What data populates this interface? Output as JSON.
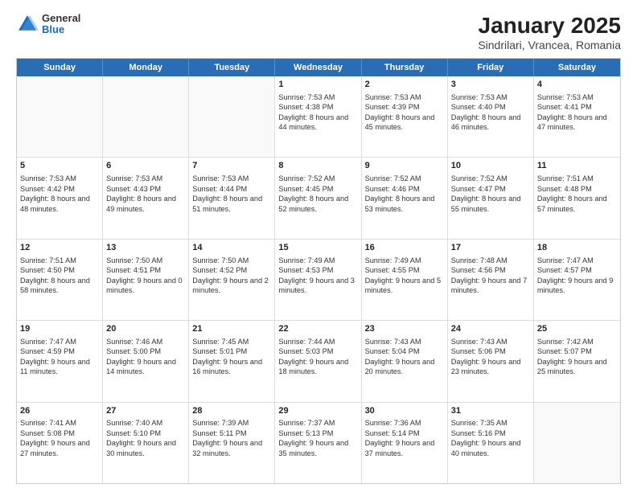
{
  "logo": {
    "general": "General",
    "blue": "Blue"
  },
  "title": "January 2025",
  "subtitle": "Sindrilari, Vrancea, Romania",
  "headers": [
    "Sunday",
    "Monday",
    "Tuesday",
    "Wednesday",
    "Thursday",
    "Friday",
    "Saturday"
  ],
  "weeks": [
    [
      {
        "day": "",
        "empty": true
      },
      {
        "day": "",
        "empty": true
      },
      {
        "day": "",
        "empty": true
      },
      {
        "day": "1",
        "sunrise": "Sunrise: 7:53 AM",
        "sunset": "Sunset: 4:38 PM",
        "daylight": "Daylight: 8 hours and 44 minutes."
      },
      {
        "day": "2",
        "sunrise": "Sunrise: 7:53 AM",
        "sunset": "Sunset: 4:39 PM",
        "daylight": "Daylight: 8 hours and 45 minutes."
      },
      {
        "day": "3",
        "sunrise": "Sunrise: 7:53 AM",
        "sunset": "Sunset: 4:40 PM",
        "daylight": "Daylight: 8 hours and 46 minutes."
      },
      {
        "day": "4",
        "sunrise": "Sunrise: 7:53 AM",
        "sunset": "Sunset: 4:41 PM",
        "daylight": "Daylight: 8 hours and 47 minutes."
      }
    ],
    [
      {
        "day": "5",
        "sunrise": "Sunrise: 7:53 AM",
        "sunset": "Sunset: 4:42 PM",
        "daylight": "Daylight: 8 hours and 48 minutes."
      },
      {
        "day": "6",
        "sunrise": "Sunrise: 7:53 AM",
        "sunset": "Sunset: 4:43 PM",
        "daylight": "Daylight: 8 hours and 49 minutes."
      },
      {
        "day": "7",
        "sunrise": "Sunrise: 7:53 AM",
        "sunset": "Sunset: 4:44 PM",
        "daylight": "Daylight: 8 hours and 51 minutes."
      },
      {
        "day": "8",
        "sunrise": "Sunrise: 7:52 AM",
        "sunset": "Sunset: 4:45 PM",
        "daylight": "Daylight: 8 hours and 52 minutes."
      },
      {
        "day": "9",
        "sunrise": "Sunrise: 7:52 AM",
        "sunset": "Sunset: 4:46 PM",
        "daylight": "Daylight: 8 hours and 53 minutes."
      },
      {
        "day": "10",
        "sunrise": "Sunrise: 7:52 AM",
        "sunset": "Sunset: 4:47 PM",
        "daylight": "Daylight: 8 hours and 55 minutes."
      },
      {
        "day": "11",
        "sunrise": "Sunrise: 7:51 AM",
        "sunset": "Sunset: 4:48 PM",
        "daylight": "Daylight: 8 hours and 57 minutes."
      }
    ],
    [
      {
        "day": "12",
        "sunrise": "Sunrise: 7:51 AM",
        "sunset": "Sunset: 4:50 PM",
        "daylight": "Daylight: 8 hours and 58 minutes."
      },
      {
        "day": "13",
        "sunrise": "Sunrise: 7:50 AM",
        "sunset": "Sunset: 4:51 PM",
        "daylight": "Daylight: 9 hours and 0 minutes."
      },
      {
        "day": "14",
        "sunrise": "Sunrise: 7:50 AM",
        "sunset": "Sunset: 4:52 PM",
        "daylight": "Daylight: 9 hours and 2 minutes."
      },
      {
        "day": "15",
        "sunrise": "Sunrise: 7:49 AM",
        "sunset": "Sunset: 4:53 PM",
        "daylight": "Daylight: 9 hours and 3 minutes."
      },
      {
        "day": "16",
        "sunrise": "Sunrise: 7:49 AM",
        "sunset": "Sunset: 4:55 PM",
        "daylight": "Daylight: 9 hours and 5 minutes."
      },
      {
        "day": "17",
        "sunrise": "Sunrise: 7:48 AM",
        "sunset": "Sunset: 4:56 PM",
        "daylight": "Daylight: 9 hours and 7 minutes."
      },
      {
        "day": "18",
        "sunrise": "Sunrise: 7:47 AM",
        "sunset": "Sunset: 4:57 PM",
        "daylight": "Daylight: 9 hours and 9 minutes."
      }
    ],
    [
      {
        "day": "19",
        "sunrise": "Sunrise: 7:47 AM",
        "sunset": "Sunset: 4:59 PM",
        "daylight": "Daylight: 9 hours and 11 minutes."
      },
      {
        "day": "20",
        "sunrise": "Sunrise: 7:46 AM",
        "sunset": "Sunset: 5:00 PM",
        "daylight": "Daylight: 9 hours and 14 minutes."
      },
      {
        "day": "21",
        "sunrise": "Sunrise: 7:45 AM",
        "sunset": "Sunset: 5:01 PM",
        "daylight": "Daylight: 9 hours and 16 minutes."
      },
      {
        "day": "22",
        "sunrise": "Sunrise: 7:44 AM",
        "sunset": "Sunset: 5:03 PM",
        "daylight": "Daylight: 9 hours and 18 minutes."
      },
      {
        "day": "23",
        "sunrise": "Sunrise: 7:43 AM",
        "sunset": "Sunset: 5:04 PM",
        "daylight": "Daylight: 9 hours and 20 minutes."
      },
      {
        "day": "24",
        "sunrise": "Sunrise: 7:43 AM",
        "sunset": "Sunset: 5:06 PM",
        "daylight": "Daylight: 9 hours and 23 minutes."
      },
      {
        "day": "25",
        "sunrise": "Sunrise: 7:42 AM",
        "sunset": "Sunset: 5:07 PM",
        "daylight": "Daylight: 9 hours and 25 minutes."
      }
    ],
    [
      {
        "day": "26",
        "sunrise": "Sunrise: 7:41 AM",
        "sunset": "Sunset: 5:08 PM",
        "daylight": "Daylight: 9 hours and 27 minutes."
      },
      {
        "day": "27",
        "sunrise": "Sunrise: 7:40 AM",
        "sunset": "Sunset: 5:10 PM",
        "daylight": "Daylight: 9 hours and 30 minutes."
      },
      {
        "day": "28",
        "sunrise": "Sunrise: 7:39 AM",
        "sunset": "Sunset: 5:11 PM",
        "daylight": "Daylight: 9 hours and 32 minutes."
      },
      {
        "day": "29",
        "sunrise": "Sunrise: 7:37 AM",
        "sunset": "Sunset: 5:13 PM",
        "daylight": "Daylight: 9 hours and 35 minutes."
      },
      {
        "day": "30",
        "sunrise": "Sunrise: 7:36 AM",
        "sunset": "Sunset: 5:14 PM",
        "daylight": "Daylight: 9 hours and 37 minutes."
      },
      {
        "day": "31",
        "sunrise": "Sunrise: 7:35 AM",
        "sunset": "Sunset: 5:16 PM",
        "daylight": "Daylight: 9 hours and 40 minutes."
      },
      {
        "day": "",
        "empty": true
      }
    ]
  ]
}
